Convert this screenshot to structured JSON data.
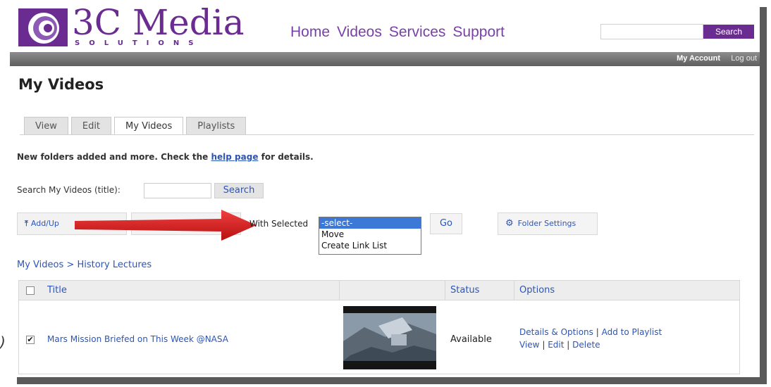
{
  "header": {
    "logo_main": "3C Media",
    "logo_sub": "SOLUTIONS",
    "nav": [
      "Home",
      "Videos",
      "Services",
      "Support"
    ],
    "search_button": "Search",
    "search_value": "",
    "account_link": "My Account",
    "logout_link": "Log out"
  },
  "page": {
    "title": "My Videos",
    "tabs": [
      "View",
      "Edit",
      "My Videos",
      "Playlists"
    ],
    "active_tab": "My Videos",
    "notice_before": "New folders added and more. Check the ",
    "notice_link": "help page",
    "notice_after": " for details."
  },
  "search": {
    "label": "Search My Videos (title):",
    "value": "",
    "button": "Search"
  },
  "actions": {
    "add_button": "Add/Up",
    "with_selected_label": "With Selected",
    "dropdown_options": [
      "-select-",
      "Move",
      "Create Link List"
    ],
    "dropdown_selected": "-select-",
    "go_button": "Go",
    "folder_settings_button": "Folder Settings"
  },
  "breadcrumb": {
    "root": "My Videos",
    "separator": ">",
    "current": "History Lectures"
  },
  "table": {
    "headers": [
      "Title",
      "",
      "Status",
      "Options"
    ],
    "rows": [
      {
        "checked": true,
        "title": "Mars Mission Briefed on This Week @NASA",
        "status": "Available",
        "options_line1": [
          "Details & Options",
          "Add to Playlist"
        ],
        "options_line2": [
          "View",
          "Edit",
          "Delete"
        ]
      }
    ]
  },
  "colors": {
    "brand_purple": "#6a2c91",
    "link_blue": "#2c55b8",
    "highlight": "#3b78d8",
    "arrow_red": "#e02020"
  },
  "corner_glyph": ")"
}
